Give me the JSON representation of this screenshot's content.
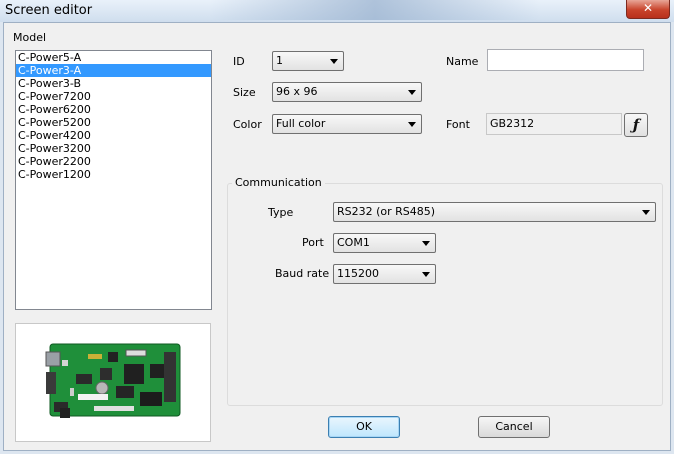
{
  "window": {
    "title": "Screen editor",
    "close_glyph": "✕"
  },
  "model": {
    "label": "Model",
    "items": [
      "C-Power5-A",
      "C-Power3-A",
      "C-Power3-B",
      "C-Power7200",
      "C-Power6200",
      "C-Power5200",
      "C-Power4200",
      "C-Power3200",
      "C-Power2200",
      "C-Power1200"
    ],
    "selected_index": 1
  },
  "form": {
    "id_label": "ID",
    "id_value": "1",
    "name_label": "Name",
    "name_value": "",
    "size_label": "Size",
    "size_value": "96 x 96",
    "color_label": "Color",
    "color_value": "Full color",
    "font_label": "Font",
    "font_value": "GB2312",
    "font_button_glyph": "ƒ"
  },
  "communication": {
    "title": "Communication",
    "type_label": "Type",
    "type_value": "RS232 (or RS485)",
    "port_label": "Port",
    "port_value": "COM1",
    "baud_label": "Baud rate",
    "baud_value": "115200"
  },
  "buttons": {
    "ok": "OK",
    "cancel": "Cancel"
  },
  "colors": {
    "selection": "#3399ff",
    "board_green": "#1f8f3a"
  }
}
